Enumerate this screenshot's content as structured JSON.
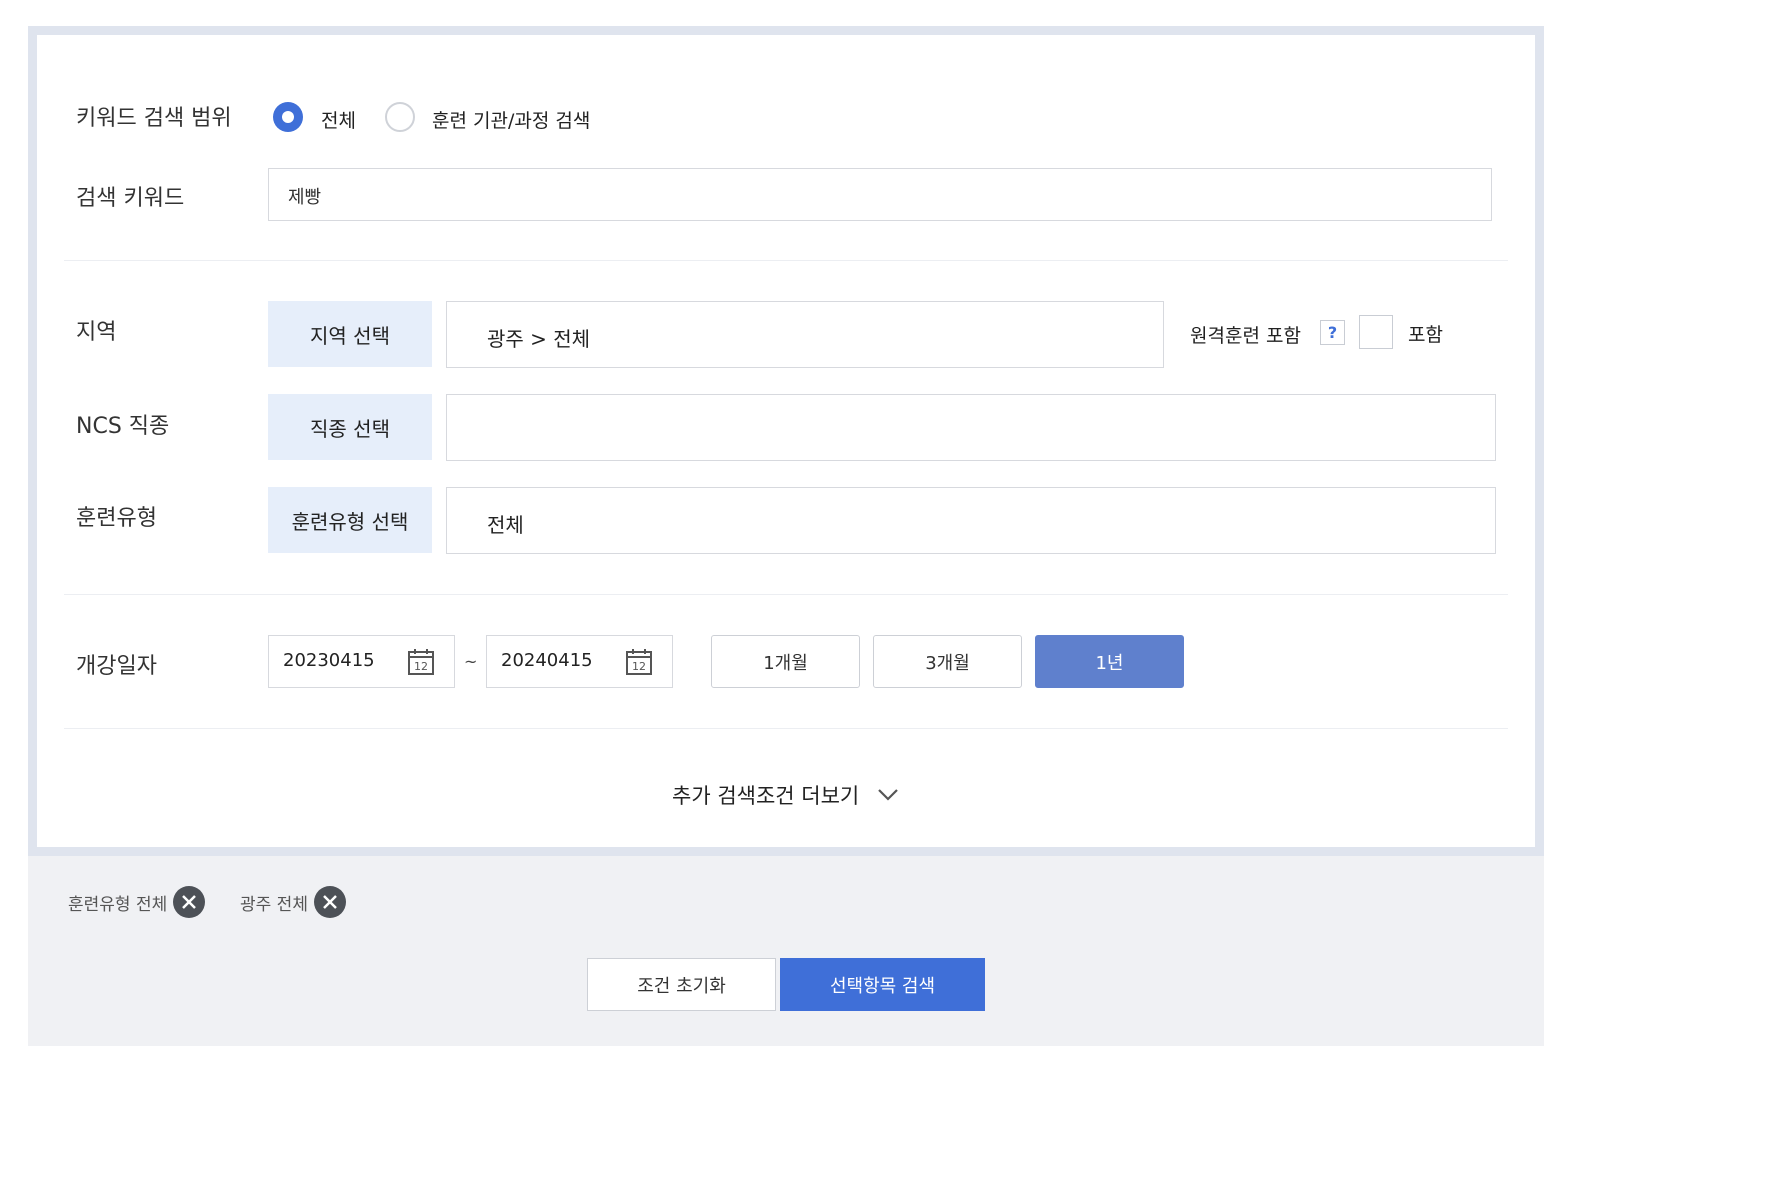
{
  "keyword_scope": {
    "label": "키워드 검색 범위",
    "options": [
      {
        "label": "전체",
        "selected": true
      },
      {
        "label": "훈련 기관/과정 검색",
        "selected": false
      }
    ]
  },
  "keyword": {
    "label": "검색 키워드",
    "value": "제빵"
  },
  "region": {
    "label": "지역",
    "button": "지역 선택",
    "value": "광주 > 전체",
    "remote_label": "원격훈련 포함",
    "help_icon": "?",
    "include_label": "포함",
    "include_checked": false
  },
  "ncs": {
    "label": "NCS 직종",
    "button": "직종 선택",
    "value": ""
  },
  "training_type": {
    "label": "훈련유형",
    "button": "훈련유형 선택",
    "value": "전체"
  },
  "open_date": {
    "label": "개강일자",
    "start": "20230415",
    "separator": "~",
    "end": "20240415",
    "calendar_icon_text": "12",
    "periods": [
      {
        "label": "1개월",
        "active": false
      },
      {
        "label": "3개월",
        "active": false
      },
      {
        "label": "1년",
        "active": true
      }
    ]
  },
  "more_conditions": {
    "label": "추가 검색조건 더보기",
    "icon": "chevron-down-icon"
  },
  "selected_tags": [
    {
      "label": "훈련유형 전체"
    },
    {
      "label": "광주 전체"
    }
  ],
  "actions": {
    "reset": "조건 초기화",
    "search": "선택항목 검색"
  },
  "colors": {
    "primary": "#3f6fd8",
    "active_period": "#5f80cd",
    "select_button_bg": "#e6eefa",
    "panel_border": "#dfe4ee",
    "bottom_bg": "#f0f1f4"
  }
}
